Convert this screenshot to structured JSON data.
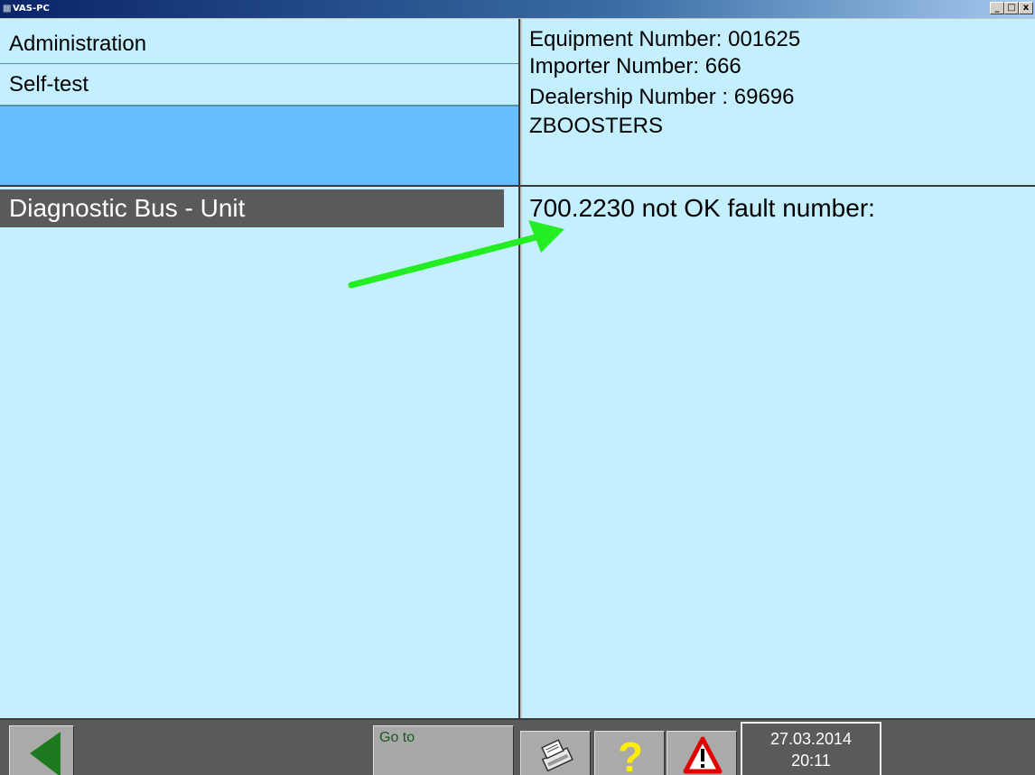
{
  "window": {
    "title": "VAS-PC",
    "controls": {
      "minimize": "_",
      "maximize": "□",
      "close": "x"
    }
  },
  "menu": {
    "items": [
      "Administration",
      "Self-test",
      ""
    ]
  },
  "info": {
    "lines": [
      "Equipment Number:  001625",
      "Importer Number:  666",
      "Dealership Number :  69696",
      "ZBOOSTERS"
    ]
  },
  "main": {
    "selected_item": "Diagnostic Bus - Unit",
    "result": "700.2230  not OK fault number:"
  },
  "annotation": {
    "arrow_color": "#22ee22"
  },
  "toolbar": {
    "back_icon": "back-arrow-icon",
    "goto_label": "Go to",
    "print_icon": "printer-icon",
    "help_icon": "question-mark-icon",
    "warning_icon": "warning-triangle-icon",
    "date": "27.03.2014",
    "time": "20:11"
  },
  "colors": {
    "panel_bg": "#c4efff",
    "selected_menu_bg": "#66bdff",
    "toolbar_bg": "#5a5a5a"
  }
}
